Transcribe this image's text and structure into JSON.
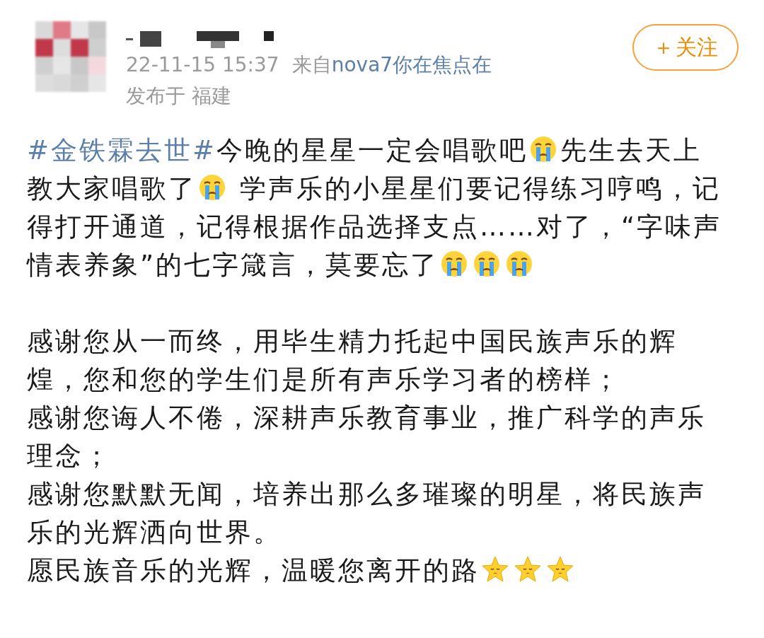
{
  "post": {
    "author": {
      "avatar": {
        "kind": "picture"
      }
    },
    "time": "22-11-15 15:37",
    "source_prefix": "来自",
    "source": "nova7你在焦点在",
    "location": "发布于 福建",
    "follow_button": {
      "icon": "＋",
      "label": "关注"
    },
    "paragraphs": [
      [
        {
          "kind": "hashtag",
          "text": "#金铁霖去世#"
        },
        {
          "kind": "text",
          "text": "今晚的星星一定会唱歌吧"
        },
        {
          "kind": "crying_emoji"
        },
        {
          "kind": "text",
          "text": "先生去天上教大家唱歌了"
        },
        {
          "kind": "crying_emoji"
        },
        {
          "kind": "text",
          "text": " 学声乐的小星星们要记得练习哼鸣，记得打开通道，记得根据作品选择支点……对了，“字味声情表养象”的七字箴言，莫要忘了"
        },
        {
          "kind": "crying_emoji"
        },
        {
          "kind": "crying_emoji"
        },
        {
          "kind": "crying_emoji"
        }
      ],
      [
        {
          "kind": "text",
          "text": "感谢您从一而终，用毕生精力托起中国民族声乐的辉煌，您和您的学生们是所有声乐学习者的榜样；"
        }
      ],
      [
        {
          "kind": "text",
          "text": "感谢您诲人不倦，深耕声乐教育事业，推广科学的声乐理念；"
        }
      ],
      [
        {
          "kind": "text",
          "text": "感谢您默默无闻，培养出那么多璀璨的明星，将民族声乐的光辉洒向世界。"
        }
      ],
      [
        {
          "kind": "text",
          "text": "愿民族音乐的光辉，温暖您离开的路"
        },
        {
          "kind": "star_emoji"
        },
        {
          "kind": "star_emoji"
        },
        {
          "kind": "star_emoji"
        }
      ]
    ]
  }
}
